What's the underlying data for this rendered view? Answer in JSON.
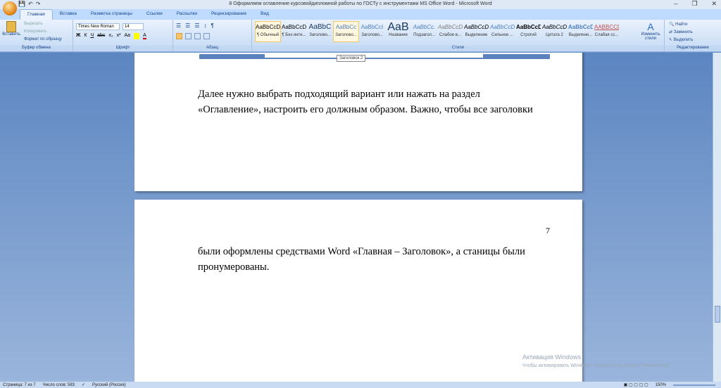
{
  "window": {
    "title": "8 Оформляем оглавление курсовойдипломной работы по ГОСТу с инструментами MS Office Word - Microsoft Word",
    "minimize": "–",
    "restore": "❐",
    "close": "✕"
  },
  "tabs": [
    "Главная",
    "Вставка",
    "Разметка страницы",
    "Ссылки",
    "Рассылки",
    "Рецензирование",
    "Вид"
  ],
  "clipboard": {
    "paste": "Вставить",
    "cut": "Вырезать",
    "copy": "Копировать",
    "format_painter": "Формат по образцу",
    "label": "Буфер обмена"
  },
  "font": {
    "name": "Times New Roman",
    "size": "14",
    "label": "Шрифт",
    "buttons": [
      "Ж",
      "К",
      "Ч",
      "abc",
      "x₂",
      "x²",
      "Aa",
      "A"
    ]
  },
  "paragraph": {
    "label": "Абзац",
    "buttons": [
      "☰",
      "☰",
      "☰",
      "☰",
      "↕",
      "¶"
    ]
  },
  "styles": {
    "label": "Стили",
    "items": [
      {
        "sample": "AaBbCcDc",
        "name": "¶ Обычный"
      },
      {
        "sample": "AaBbCcDc",
        "name": "¶ Без инте..."
      },
      {
        "sample": "AaBbC",
        "name": "Заголово..."
      },
      {
        "sample": "AaBbCc",
        "name": "Заголово..."
      },
      {
        "sample": "AaBbCcI",
        "name": "Заголово..."
      },
      {
        "sample": "AaB",
        "name": "Название"
      },
      {
        "sample": "AaBbCc.",
        "name": "Подзагол..."
      },
      {
        "sample": "AaBbCcDi",
        "name": "Слабое в..."
      },
      {
        "sample": "AaBbCcDi",
        "name": "Выделение"
      },
      {
        "sample": "AaBbCcDi",
        "name": "Сильное ..."
      },
      {
        "sample": "AaBbCcDc",
        "name": "Строгий"
      },
      {
        "sample": "AaBbCcDi",
        "name": "Цитата 2"
      },
      {
        "sample": "AaBbCcDi",
        "name": "Выделенн..."
      },
      {
        "sample": "AABBCCDC",
        "name": "Слабая сс..."
      }
    ],
    "change": "Изменить стили"
  },
  "editing": {
    "label": "Редактирование",
    "find": "Найти",
    "replace": "Заменить",
    "select": "Выделить"
  },
  "tooltip": "Заголовок 2",
  "page1": {
    "lines": [
      "Далее нужно выбрать подходящий вариант или нажать на раздел",
      "«Оглавление», настроить его должным образом. Важно, чтобы все заголовки"
    ]
  },
  "page2": {
    "number": "7",
    "lines": [
      "были оформлены средствами Word «Главная – Заголовок», а станицы были",
      "пронумерованы."
    ]
  },
  "watermark": {
    "title": "Активация Windows",
    "sub": "Чтобы активировать Windows, перейдите в раздел \"Параметры\"."
  },
  "status": {
    "page": "Страница: 7 из 7",
    "words": "Число слов: 583",
    "lang": "Русский (Россия)",
    "zoom": "150%"
  }
}
